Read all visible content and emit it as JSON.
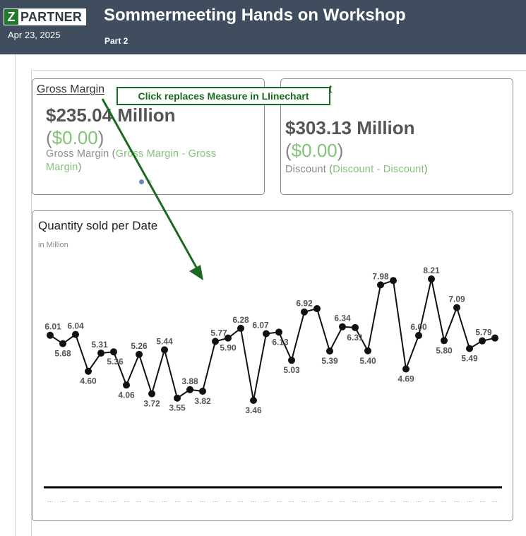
{
  "header": {
    "logo_mark": "Z",
    "logo_text": "PARTNER",
    "date": "Apr 23, 2025",
    "title": "Sommermeeting Hands on Workshop",
    "subtitle": "Part 2"
  },
  "kpi_gross_margin": {
    "title": "Gross Margin",
    "value": "$235.04 Million",
    "delta_open": "(",
    "delta_value": "$0.00",
    "delta_close": ")",
    "desc_measure": "Gross Margin",
    "desc_open": " (",
    "desc_compare": "Gross Margin - Gross Margin",
    "desc_close": ")"
  },
  "kpi_discount": {
    "title": "t",
    "value": "$303.13 Million",
    "delta_open": "(",
    "delta_value": "$0.00",
    "delta_close": ")",
    "desc_measure": "Discount",
    "desc_open": " (",
    "desc_compare": "Discount - Discount",
    "desc_close": ")"
  },
  "callout": {
    "text": "Click replaces Measure in LIinechart"
  },
  "colors": {
    "header_bg": "#3f4d5e",
    "accent_green": "#84c27a",
    "callout_green": "#1a6b1f",
    "line": "#111111"
  },
  "chart_data": {
    "type": "line",
    "title": "Quantity sold per Date",
    "unit": "in Million",
    "xlabel": "",
    "ylabel": "",
    "x_tick_labels": [
      "...",
      "...",
      "...",
      "...",
      "...",
      "...",
      "...",
      "...",
      "...",
      "...",
      "...",
      "...",
      "...",
      "...",
      "...",
      "...",
      "...",
      "...",
      "...",
      "...",
      "...",
      "...",
      "...",
      "...",
      "...",
      "...",
      "...",
      "...",
      "...",
      "...",
      "...",
      "...",
      "...",
      "...",
      "...",
      "..."
    ],
    "series": [
      {
        "values": [
          6.01,
          5.68,
          6.04,
          4.6,
          5.31,
          5.36,
          4.06,
          5.26,
          3.72,
          5.44,
          3.55,
          3.88,
          3.82,
          5.77,
          5.9,
          6.28,
          3.46,
          6.07,
          6.13,
          5.03,
          6.92,
          7.05,
          5.39,
          6.34,
          6.31,
          5.4,
          7.98,
          8.15,
          4.69,
          6.0,
          8.21,
          5.8,
          7.09,
          5.49,
          5.79,
          5.9
        ],
        "labels": [
          "6.01",
          "5.68",
          "6.04",
          "4.60",
          "5.31",
          "5.36",
          "4.06",
          "5.26",
          "3.72",
          "5.44",
          "3.55",
          "3.88",
          "3.82",
          "5.77",
          "5.90",
          "6.28",
          "3.46",
          "6.07",
          "6.13",
          "5.03",
          "6.92",
          "",
          "5.39",
          "6.34",
          "6.31",
          "5.40",
          "7.98",
          "",
          "4.69",
          "6.00",
          "8.21",
          "5.80",
          "7.09",
          "5.49",
          "5.79",
          ""
        ]
      }
    ],
    "grid": false,
    "legend": "none"
  }
}
